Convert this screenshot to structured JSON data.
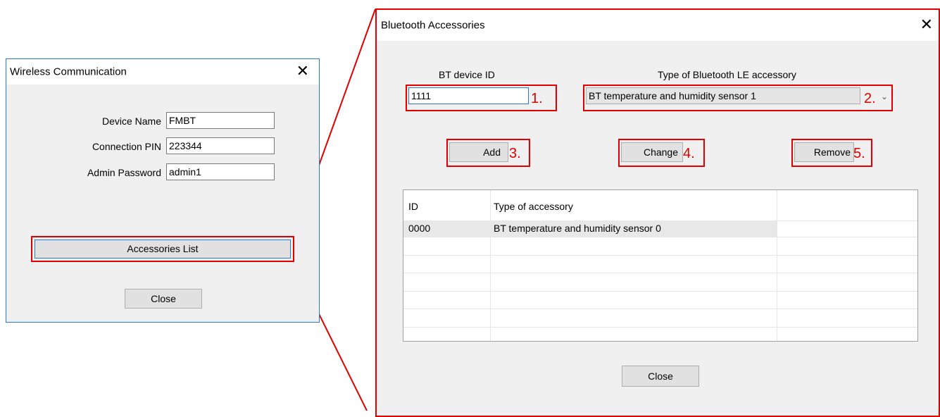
{
  "wireless_dialog": {
    "title": "Wireless Communication",
    "device_name_label": "Device Name",
    "device_name_value": "FMBT",
    "connection_pin_label": "Connection PIN",
    "connection_pin_value": "223344",
    "admin_password_label": "Admin Password",
    "admin_password_value": "admin1",
    "accessories_button": "Accessories List",
    "close_button": "Close"
  },
  "bt_dialog": {
    "title": "Bluetooth Accessories",
    "device_id_label": "BT device ID",
    "device_id_value": "1111",
    "type_label": "Type of Bluetooth LE accessory",
    "type_value": "BT temperature and humidity sensor 1",
    "add_button": "Add",
    "change_button": "Change",
    "remove_button": "Remove",
    "table": {
      "columns": [
        "ID",
        "Type of accessory"
      ],
      "rows": [
        {
          "id": "0000",
          "type": "BT temperature and humidity sensor 0"
        }
      ]
    },
    "close_button": "Close"
  },
  "annotations": {
    "n1": "1.",
    "n2": "2.",
    "n3": "3.",
    "n4": "4.",
    "n5": "5."
  },
  "colors": {
    "highlight": "#e00000",
    "window_border": "#2b79d0",
    "dialog_bg": "#f0f0f0"
  }
}
